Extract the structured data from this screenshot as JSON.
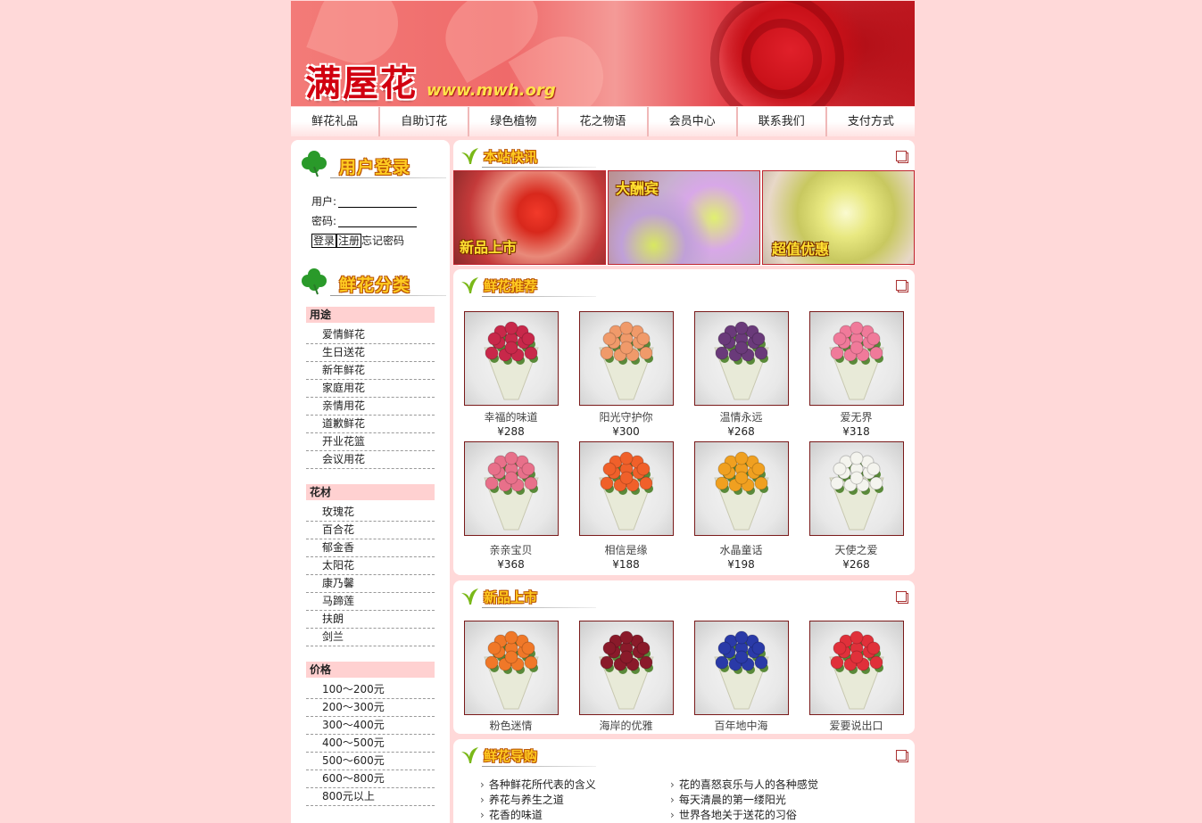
{
  "header": {
    "logo": "满屋花",
    "url": "www.mwh.org"
  },
  "nav": [
    "鲜花礼品",
    "自助订花",
    "绿色植物",
    "花之物语",
    "会员中心",
    "联系我们",
    "支付方式"
  ],
  "login": {
    "title": "用户登录",
    "user_label": "用户:",
    "password_label": "密码:",
    "login_button": "登录",
    "register_button": "注册",
    "forgot_link": "忘记密码"
  },
  "categories": {
    "title": "鲜花分类",
    "groups": [
      {
        "name": "用途",
        "items": [
          "爱情鲜花",
          "生日送花",
          "新年鲜花",
          "家庭用花",
          "亲情用花",
          "道歉鲜花",
          "开业花篮",
          "会议用花"
        ]
      },
      {
        "name": "花材",
        "items": [
          "玫瑰花",
          "百合花",
          "郁金香",
          "太阳花",
          "康乃馨",
          "马蹄莲",
          "扶朗",
          "剑兰"
        ]
      },
      {
        "name": "价格",
        "items": [
          "100～200元",
          "200～300元",
          "300～400元",
          "400～500元",
          "500～600元",
          "600～800元",
          "800元以上"
        ]
      }
    ]
  },
  "news": {
    "title": "本站快讯",
    "promos": [
      "新品上市",
      "大酬宾",
      "超值优惠"
    ]
  },
  "recommend": {
    "title": "鲜花推荐",
    "products": [
      {
        "name": "幸福的味道",
        "price": "¥288",
        "color": "#c8284a"
      },
      {
        "name": "阳光守护你",
        "price": "¥300",
        "color": "#f09a6a"
      },
      {
        "name": "温情永远",
        "price": "¥268",
        "color": "#6a3a7a"
      },
      {
        "name": "爱无界",
        "price": "¥318",
        "color": "#f07a9a"
      },
      {
        "name": "亲亲宝贝",
        "price": "¥368",
        "color": "#e8708a"
      },
      {
        "name": "相信是缘",
        "price": "¥188",
        "color": "#f0602a"
      },
      {
        "name": "水晶童话",
        "price": "¥198",
        "color": "#f0a020"
      },
      {
        "name": "天使之爱",
        "price": "¥268",
        "color": "#f4f4ee"
      }
    ]
  },
  "new_arrivals": {
    "title": "新品上市",
    "products": [
      {
        "name": "粉色迷情",
        "color": "#f07828"
      },
      {
        "name": "海岸的优雅",
        "color": "#8a1a2a"
      },
      {
        "name": "百年地中海",
        "color": "#2a3aa8"
      },
      {
        "name": "爱要说出口",
        "color": "#e0303a"
      }
    ]
  },
  "guide": {
    "title": "鲜花导购",
    "left": [
      "各种鲜花所代表的含义",
      "养花与养生之道",
      "花香的味道"
    ],
    "right": [
      "花的喜怒哀乐与人的各种感觉",
      "每天清晨的第一缕阳光",
      "世界各地关于送花的习俗"
    ]
  }
}
